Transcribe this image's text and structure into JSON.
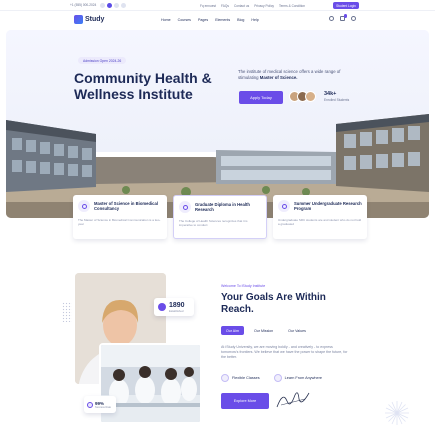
{
  "topbar": {
    "phone": "+1 (555) 000-2024",
    "links": [
      "Fq ennuest",
      "FAQs",
      "Contact us",
      "Privacy Policy",
      "Terms & Condition"
    ],
    "login": "Student Login"
  },
  "brand": {
    "name": "Study"
  },
  "nav": {
    "items": [
      "Home",
      "Courses",
      "Pages",
      "Elements",
      "Blog",
      "Help"
    ],
    "cart_count": "0"
  },
  "hero": {
    "tag": "Admission Open 2024-26",
    "title": "Community Health & Wellness Institute",
    "description_prefix": "The institute of medical science offers a wide range of stimulating ",
    "description_bold": "Master of Science.",
    "apply_label": "Apply Today",
    "stat_value": "34k+",
    "stat_label": "Enrolled Students"
  },
  "programs": [
    {
      "title": "Master of Science in Biomedical Consultancy",
      "desc": "The Master of Science in Biomedical Communication is a two-year"
    },
    {
      "title": "Graduate Diploma in Health Research",
      "desc": "The College of Health Sciences recognizes that it is imperative to conduct"
    },
    {
      "title": "Summer Undergraduate Research Program",
      "desc": "Undergraduate SRC students are and student who do not hold a graduated"
    }
  ],
  "about": {
    "welcome": "Welcome To iStudy Institute",
    "title": "Your Goals Are Within Reach.",
    "tabs": [
      "Our Aim",
      "Our Mission",
      "Our Values"
    ],
    "active_tab": "Our Aim",
    "paragraph": "At iStudy University, we are moving boldly - and creatively - to express tomorrow's frontiers. We believe that we have the power to shape the future, for the better.",
    "features": [
      "Flexible Classes",
      "Learn From Anywhere"
    ],
    "explore_label": "Explore More",
    "founded_value": "1890",
    "founded_label": "Established",
    "success_value": "99%",
    "success_label": "Success Rate"
  },
  "colors": {
    "accent": "#6a4de8",
    "heading": "#1d2a57",
    "muted": "#8a92ac"
  }
}
